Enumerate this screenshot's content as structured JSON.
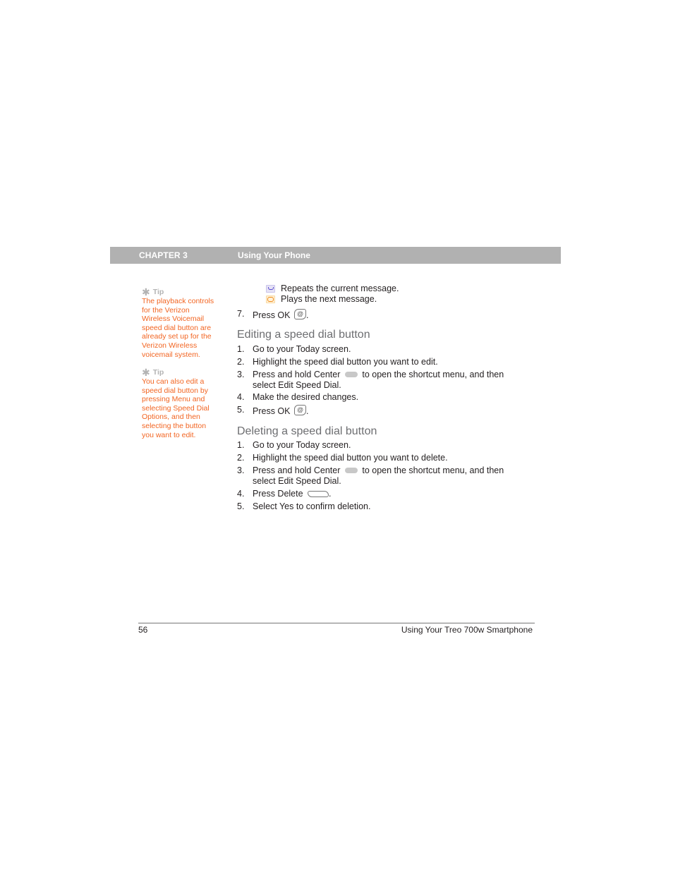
{
  "header": {
    "chapter": "CHAPTER 3",
    "title": "Using Your Phone",
    "bar_color": "#b1b1b1"
  },
  "sidebar": {
    "tips": [
      {
        "label": "Tip",
        "icon": "asterisk-icon",
        "lines": [
          "The playback controls",
          "for the Verizon",
          "Wireless Voicemail",
          "speed dial button are",
          "already set up for the",
          "Verizon Wireless",
          "voicemail system."
        ]
      },
      {
        "label": "Tip",
        "icon": "asterisk-icon",
        "lines": [
          "You can also edit a",
          "speed dial button by",
          "pressing Menu and",
          "selecting Speed Dial",
          "Options, and then",
          "selecting the button",
          "you want to edit."
        ]
      }
    ],
    "tip_color": "#f26522"
  },
  "main": {
    "playback": [
      {
        "icon": "repeat-icon",
        "text": "Repeats the current message."
      },
      {
        "icon": "next-message-icon",
        "text": "Plays the next message."
      }
    ],
    "step7": {
      "num": "7.",
      "text": "Press OK",
      "suffix": ".",
      "icon": "ok-button-icon"
    },
    "editing": {
      "heading": "Editing a speed dial button",
      "steps": [
        {
          "num": "1.",
          "text": "Go to your Today screen."
        },
        {
          "num": "2.",
          "text": "Highlight the speed dial button you want to edit."
        },
        {
          "num": "3.",
          "text_before": "Press and hold Center",
          "text_after": "to open the shortcut menu, and then",
          "line2": "select Edit Speed Dial.",
          "icon": "center-button-icon"
        },
        {
          "num": "4.",
          "text": "Make the desired changes."
        },
        {
          "num": "5.",
          "text": "Press OK",
          "suffix": ".",
          "icon": "ok-button-icon"
        }
      ]
    },
    "deleting": {
      "heading": "Deleting a speed dial button",
      "steps": [
        {
          "num": "1.",
          "text": "Go to your Today screen."
        },
        {
          "num": "2.",
          "text": "Highlight the speed dial button you want to delete."
        },
        {
          "num": "3.",
          "text_before": "Press and hold Center",
          "text_after": "to open the shortcut menu, and then",
          "line2": "select Edit Speed Dial.",
          "icon": "center-button-icon"
        },
        {
          "num": "4.",
          "text": "Press Delete",
          "suffix": ".",
          "icon": "delete-button-icon"
        },
        {
          "num": "5.",
          "text": "Select Yes to confirm deletion."
        }
      ]
    }
  },
  "footer": {
    "page_number": "56",
    "title": "Using Your Treo 700w Smartphone"
  }
}
